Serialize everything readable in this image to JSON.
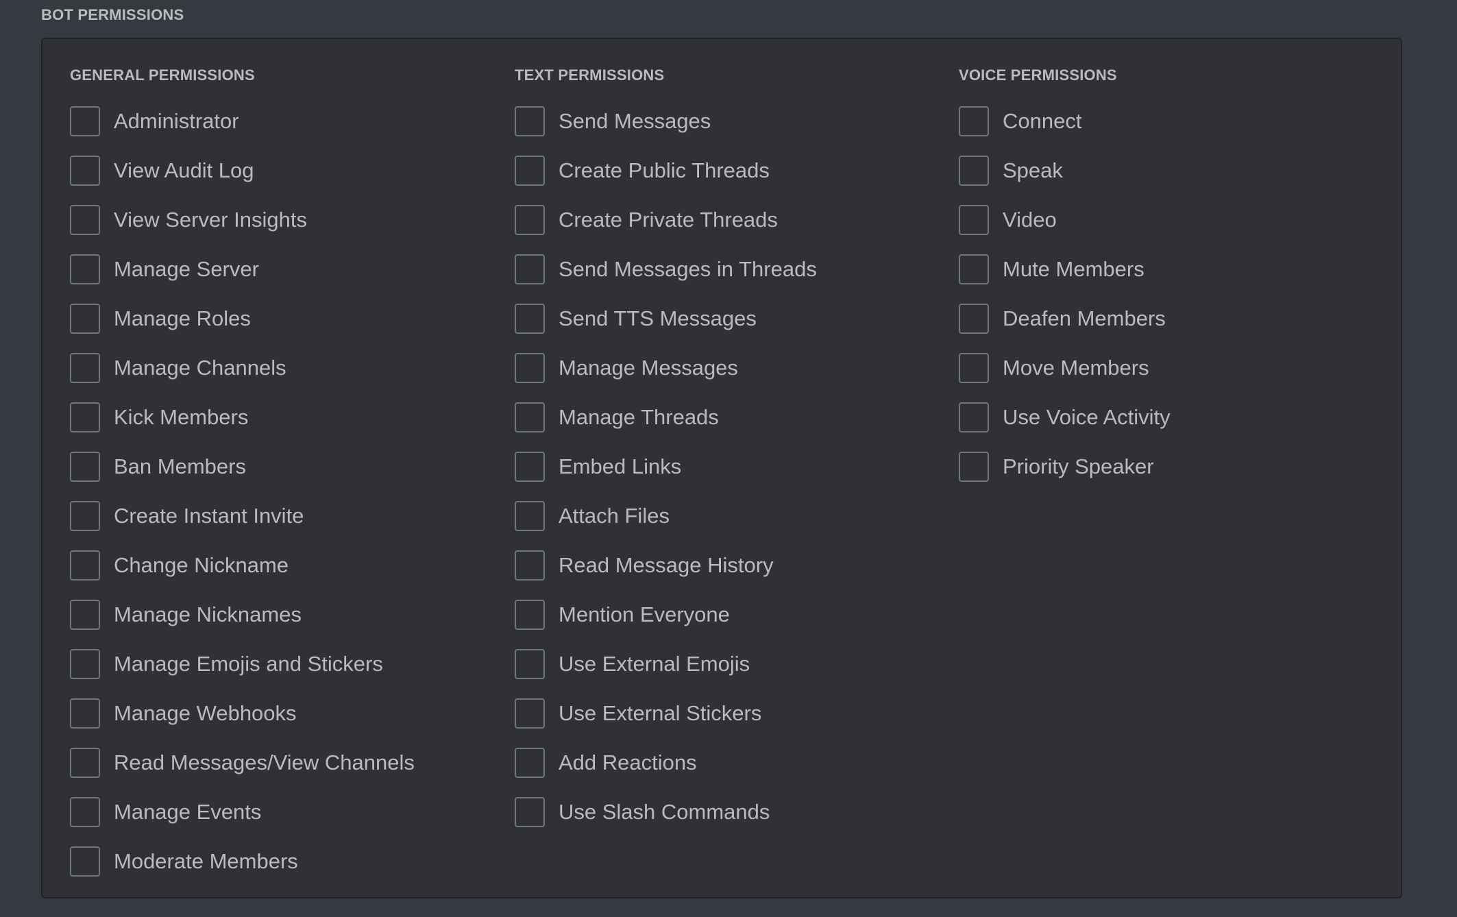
{
  "title": "BOT PERMISSIONS",
  "columns": [
    {
      "title": "GENERAL PERMISSIONS",
      "items": [
        "Administrator",
        "View Audit Log",
        "View Server Insights",
        "Manage Server",
        "Manage Roles",
        "Manage Channels",
        "Kick Members",
        "Ban Members",
        "Create Instant Invite",
        "Change Nickname",
        "Manage Nicknames",
        "Manage Emojis and Stickers",
        "Manage Webhooks",
        "Read Messages/View Channels",
        "Manage Events",
        "Moderate Members"
      ]
    },
    {
      "title": "TEXT PERMISSIONS",
      "items": [
        "Send Messages",
        "Create Public Threads",
        "Create Private Threads",
        "Send Messages in Threads",
        "Send TTS Messages",
        "Manage Messages",
        "Manage Threads",
        "Embed Links",
        "Attach Files",
        "Read Message History",
        "Mention Everyone",
        "Use External Emojis",
        "Use External Stickers",
        "Add Reactions",
        "Use Slash Commands"
      ]
    },
    {
      "title": "VOICE PERMISSIONS",
      "items": [
        "Connect",
        "Speak",
        "Video",
        "Mute Members",
        "Deafen Members",
        "Move Members",
        "Use Voice Activity",
        "Priority Speaker"
      ]
    }
  ],
  "checked": {
    "general": [
      false,
      false,
      false,
      false,
      false,
      false,
      false,
      false,
      false,
      false,
      false,
      false,
      false,
      false,
      false,
      false
    ],
    "text": [
      false,
      false,
      false,
      false,
      false,
      false,
      false,
      false,
      false,
      false,
      false,
      false,
      false,
      false,
      false
    ],
    "voice": [
      false,
      false,
      false,
      false,
      false,
      false,
      false,
      false
    ]
  },
  "colors": {
    "background": "#36393f",
    "panel": "#2f3136",
    "text": "#b9bbbe",
    "checkbox_border": "#72767d"
  }
}
